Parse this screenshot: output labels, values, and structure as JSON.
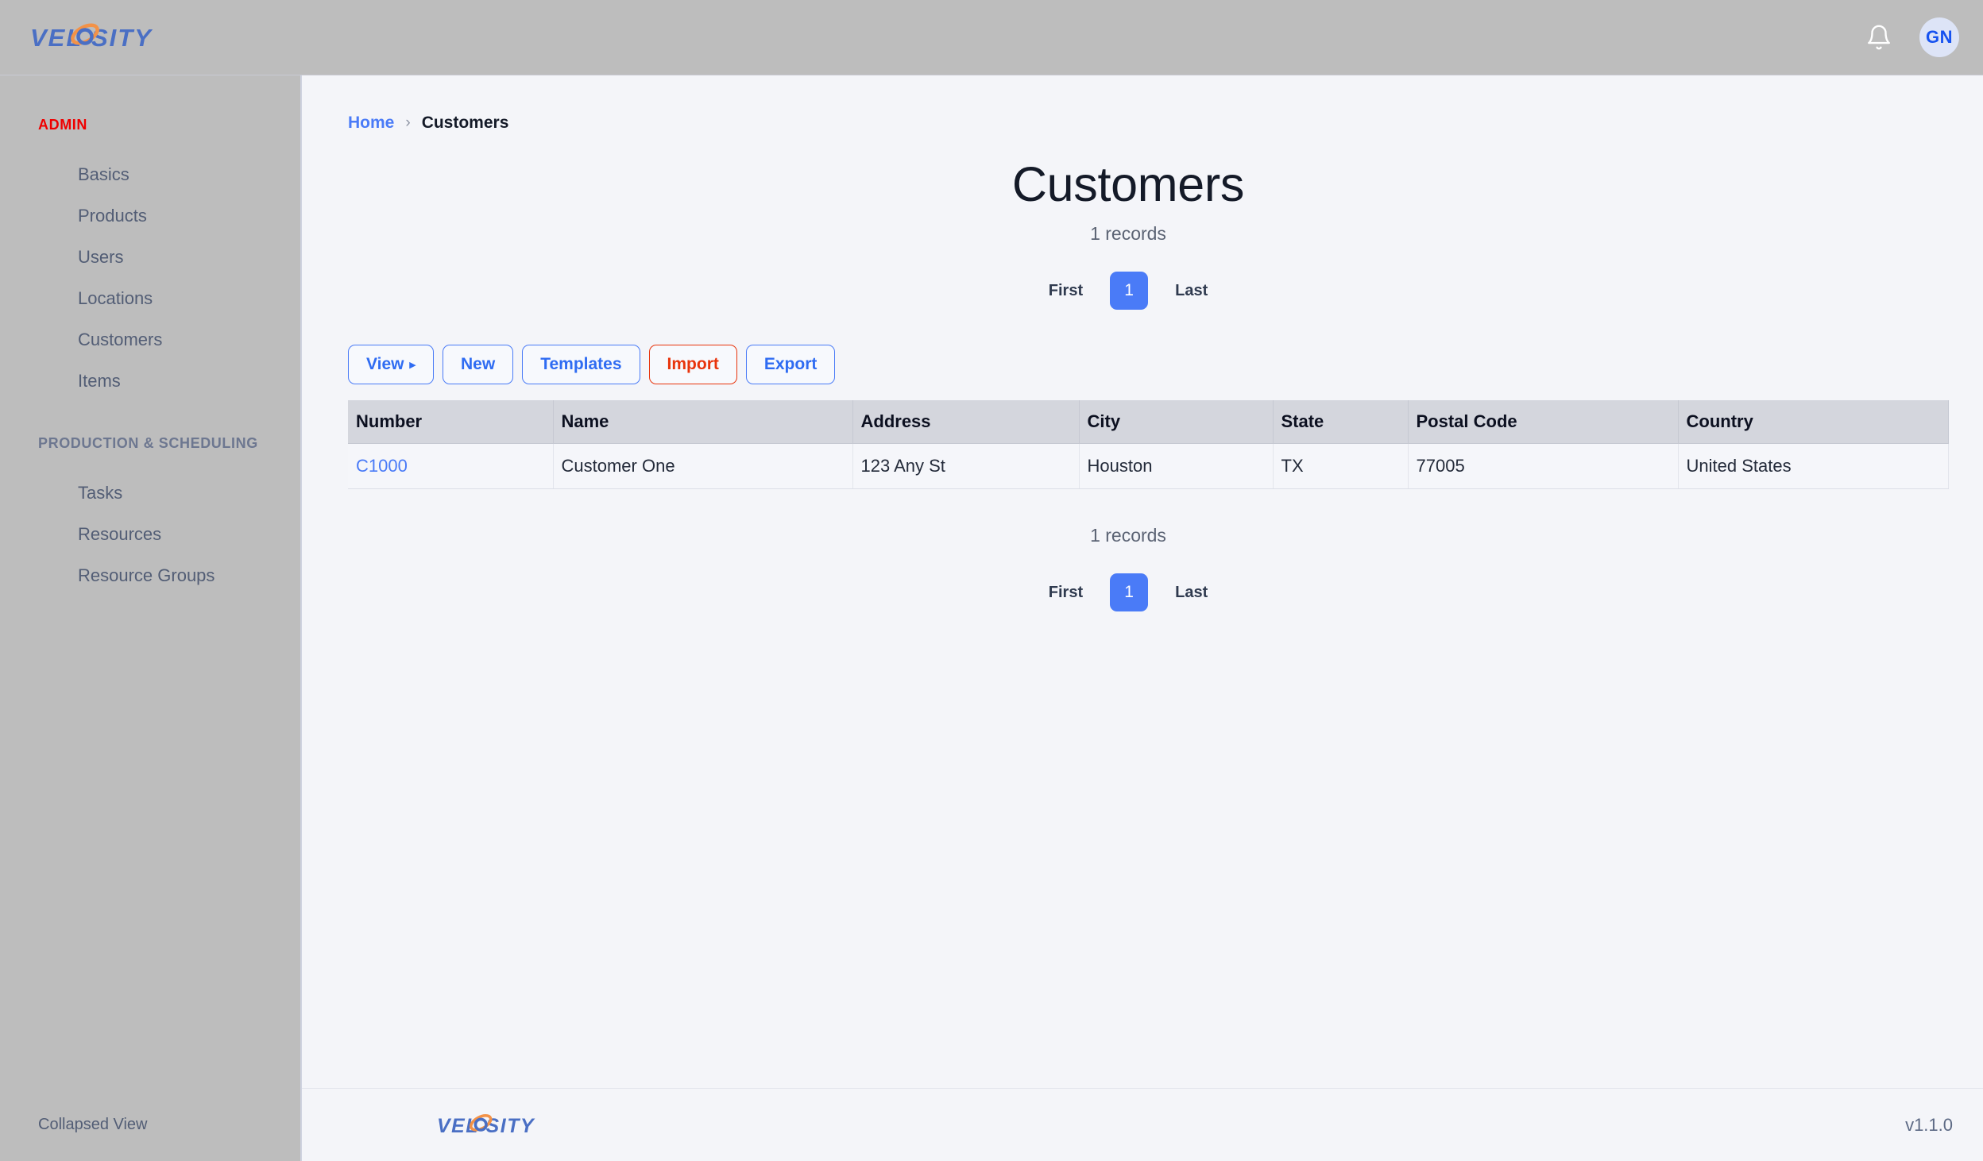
{
  "brand": {
    "name": "VELOSITY",
    "text_before": "VEL",
    "text_after": "SITY",
    "accent_color": "#f39247",
    "color": "#4a6fc4"
  },
  "topbar": {
    "notifications_icon": "bell-icon",
    "avatar_initials": "GN",
    "background": "#bdbdbd"
  },
  "sidebar": {
    "sections": [
      {
        "title": "ADMIN",
        "title_color": "#ef0000",
        "items": [
          {
            "label": "Basics"
          },
          {
            "label": "Products"
          },
          {
            "label": "Users"
          },
          {
            "label": "Locations"
          },
          {
            "label": "Customers"
          },
          {
            "label": "Items"
          }
        ]
      },
      {
        "title": "PRODUCTION & SCHEDULING",
        "title_color": "#6d7790",
        "items": [
          {
            "label": "Tasks"
          },
          {
            "label": "Resources"
          },
          {
            "label": "Resource Groups"
          }
        ]
      }
    ],
    "footer_label": "Collapsed View"
  },
  "breadcrumb": {
    "home": "Home",
    "separator": "›",
    "current": "Customers"
  },
  "page": {
    "title": "Customers",
    "records_top": "1 records",
    "records_bottom": "1 records"
  },
  "pagination": {
    "first": "First",
    "current_page": "1",
    "last": "Last",
    "accent": "#4a7bf7"
  },
  "toolbar": {
    "buttons": [
      {
        "label": "View",
        "caret": "▸",
        "variant": "primary"
      },
      {
        "label": "New",
        "variant": "primary"
      },
      {
        "label": "Templates",
        "variant": "primary"
      },
      {
        "label": "Import",
        "variant": "danger"
      },
      {
        "label": "Export",
        "variant": "primary"
      }
    ]
  },
  "table": {
    "columns": [
      "Number",
      "Name",
      "Address",
      "City",
      "State",
      "Postal Code",
      "Country"
    ],
    "rows": [
      {
        "number": "C1000",
        "name": "Customer One",
        "address": "123 Any St",
        "city": "Houston",
        "state": "TX",
        "postal_code": "77005",
        "country": "United States"
      }
    ]
  },
  "footer": {
    "version": "v1.1.0"
  }
}
